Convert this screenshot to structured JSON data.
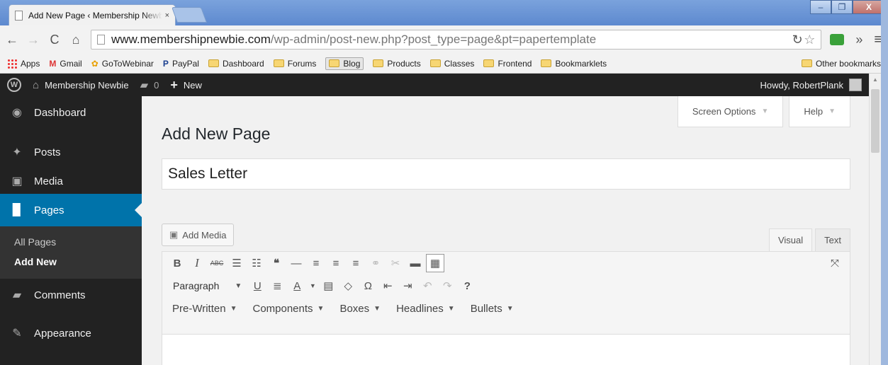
{
  "browser": {
    "tab_title": "Add New Page ‹ Membership Newbie",
    "tab_close": "×",
    "url_host": "www.membershipnewbie.com",
    "url_path": "/wp-admin/post-new.php?post_type=page&pt=papertemplate",
    "window_controls": [
      "–",
      "❐",
      "X"
    ],
    "bookmarks": [
      {
        "label": "Apps",
        "icon": "apps-icon"
      },
      {
        "label": "Gmail",
        "icon": "gmail-icon"
      },
      {
        "label": "GoToWebinar",
        "icon": "gotowebinar-icon"
      },
      {
        "label": "PayPal",
        "icon": "paypal-icon"
      },
      {
        "label": "Dashboard",
        "icon": "folder-icon"
      },
      {
        "label": "Forums",
        "icon": "folder-icon"
      },
      {
        "label": "Blog",
        "icon": "folder-icon"
      },
      {
        "label": "Products",
        "icon": "folder-icon"
      },
      {
        "label": "Classes",
        "icon": "folder-icon"
      },
      {
        "label": "Frontend",
        "icon": "folder-icon"
      },
      {
        "label": "Bookmarklets",
        "icon": "folder-icon"
      }
    ],
    "other_bookmarks": "Other bookmarks"
  },
  "adminbar": {
    "site_name": "Membership Newbie",
    "comments_count": "0",
    "new_label": "New",
    "howdy": "Howdy, RobertPlank"
  },
  "sidebar": {
    "items": [
      {
        "label": "Dashboard"
      },
      {
        "label": "Posts"
      },
      {
        "label": "Media"
      },
      {
        "label": "Pages"
      },
      {
        "label": "Comments"
      },
      {
        "label": "Appearance"
      }
    ],
    "submenu": [
      "All Pages",
      "Add New"
    ]
  },
  "main": {
    "screen_options": "Screen Options",
    "help": "Help",
    "page_title": "Add New Page",
    "post_title_value": "Sales Letter",
    "add_media": "Add Media",
    "tab_visual": "Visual",
    "tab_text": "Text",
    "format_select": "Paragraph",
    "dropdowns": [
      "Pre-Written",
      "Components",
      "Boxes",
      "Headlines",
      "Bullets"
    ]
  },
  "colors": {
    "admin_dark": "#222222",
    "accent_blue": "#0073aa",
    "content_bg": "#f1f1f1"
  }
}
